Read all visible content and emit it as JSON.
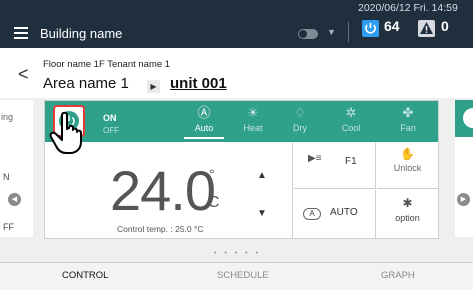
{
  "topbar": {
    "building": "Building name",
    "datetime": "2020/06/12 Fri. 14:59",
    "on_count": "64",
    "warn_count": "0",
    "dropdown_glyph": "▼"
  },
  "header": {
    "floor": "Floor name 1F Tenant name 1",
    "area": "Area name 1",
    "unit": "unit 001",
    "back_glyph": "<",
    "arrow_glyph": "▶"
  },
  "side": {
    "left_text_1": "ing",
    "left_text_2": "N",
    "left_text_3": "FF"
  },
  "control": {
    "on_label": "ON",
    "off_label": "OFF",
    "modes": [
      {
        "icon": "Ⓐ",
        "label": "Auto"
      },
      {
        "icon": "☀",
        "label": "Heat"
      },
      {
        "icon": "♢",
        "label": "Dry"
      },
      {
        "icon": "✲",
        "label": "Cool"
      },
      {
        "icon": "✤",
        "label": "Fan"
      }
    ],
    "active_mode": "Auto",
    "temperature": "24.0",
    "degree": "°",
    "unit_c": "C",
    "control_temp": "Control temp. : 25.0 °C",
    "up_glyph": "▲",
    "down_glyph": "▼",
    "fan_speed": "F1",
    "unlock_label": "Unlock",
    "auto_label": "AUTO",
    "option_label": "option"
  },
  "pager": {
    "dots": "• • • • •"
  },
  "tabs": [
    {
      "label": "CONTROL"
    },
    {
      "label": "SCHEDULE"
    },
    {
      "label": "GRAPH"
    }
  ],
  "colors": {
    "topbar": "#1f2f3d",
    "accent": "#2fa08a",
    "power_highlight": "#e33b3b",
    "on_badge": "#2f9df2"
  }
}
